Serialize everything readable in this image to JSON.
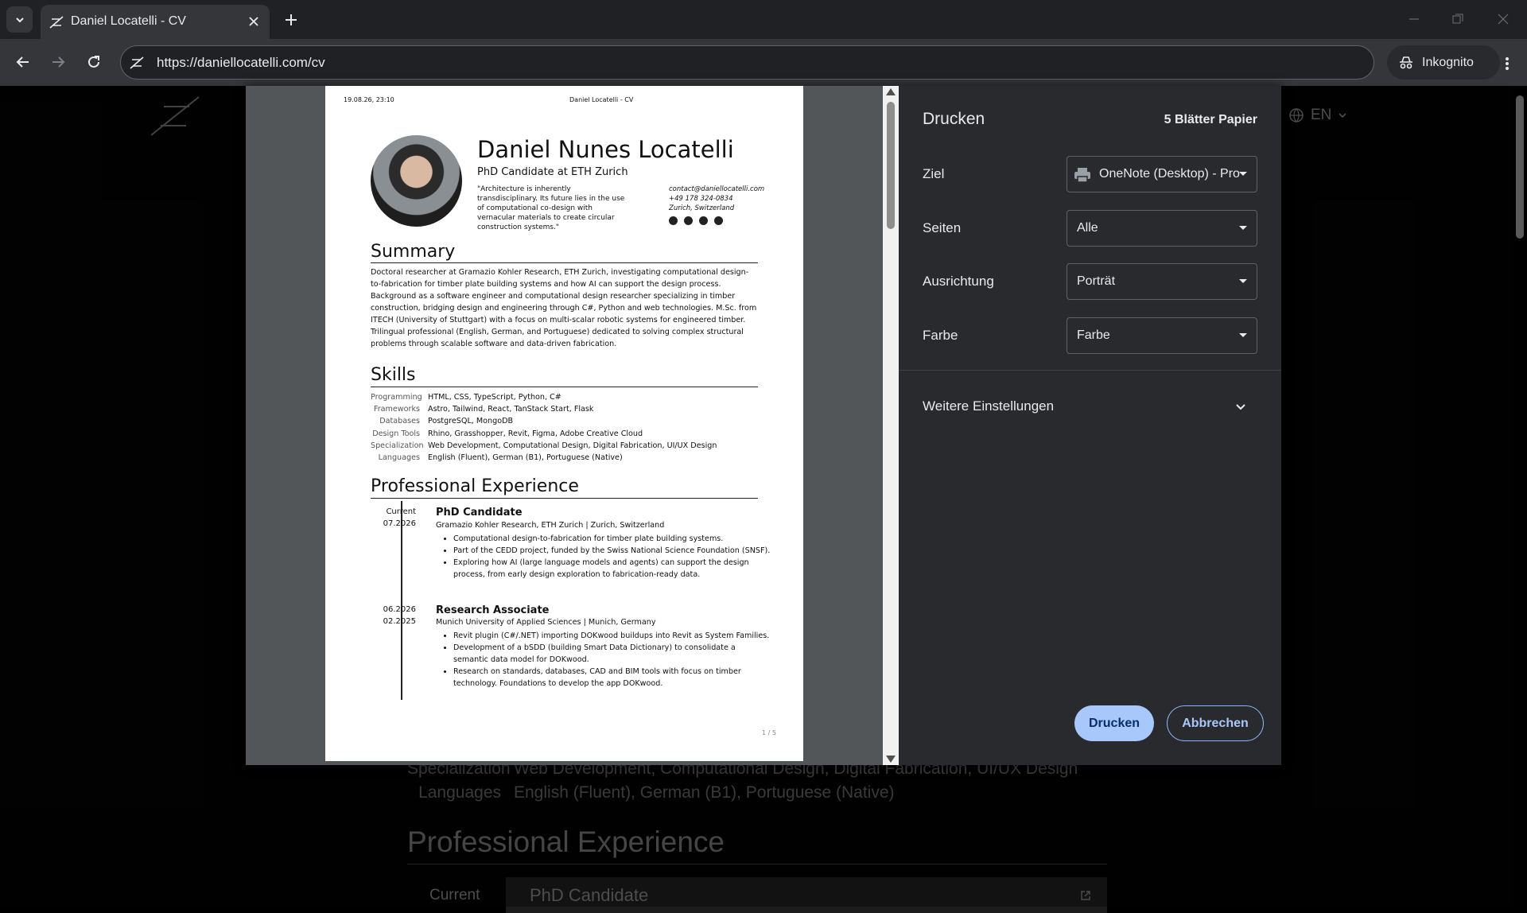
{
  "browser": {
    "tab_title": "Daniel Locatelli - CV",
    "url": "https://daniellocatelli.com/cv",
    "incognito_label": "Inkognito"
  },
  "site": {
    "lang": "EN",
    "bg_skills": [
      {
        "label": "Specialization",
        "value": "Web Development, Computational Design, Digital Fabrication, UI/UX Design"
      },
      {
        "label": "Languages",
        "value": "English (Fluent), German (B1), Portuguese (Native)"
      }
    ],
    "bg_heading": "Professional Experience",
    "bg_current": "Current",
    "bg_card_title": "PhD Candidate"
  },
  "cv": {
    "print_date": "19.08.26, 23:10",
    "print_title": "Daniel Locatelli - CV",
    "name": "Daniel Nunes Locatelli",
    "role": "PhD Candidate at ETH Zurich",
    "quote": "\"Architecture is inherently transdisciplinary. Its future lies in the use of computational co-design with vernacular materials to create circular construction systems.\"",
    "contact": [
      "contact@daniellocatelli.com",
      "+49 178 324-0834",
      "Zurich, Switzerland"
    ],
    "summary_heading": "Summary",
    "summary": "Doctoral researcher at Gramazio Kohler Research, ETH Zurich, investigating computational design-to-fabrication for timber plate building systems and how AI can support the design process. Background as a software engineer and computational design researcher specializing in timber construction, bridging design and engineering through C#, Python and web technologies. M.Sc. from ITECH (University of Stuttgart) with a focus on multi-scalar robotic systems for engineered timber. Trilingual professional (English, German, and Portuguese) dedicated to solving complex structural problems through scalable software and data-driven fabrication.",
    "skills_heading": "Skills",
    "skills": [
      {
        "label": "Programming",
        "value": "HTML, CSS, TypeScript, Python, C#"
      },
      {
        "label": "Frameworks",
        "value": "Astro, Tailwind, React, TanStack Start, Flask"
      },
      {
        "label": "Databases",
        "value": "PostgreSQL, MongoDB"
      },
      {
        "label": "Design Tools",
        "value": "Rhino, Grasshopper, Revit, Figma, Adobe Creative Cloud"
      },
      {
        "label": "Specialization",
        "value": "Web Development, Computational Design, Digital Fabrication, UI/UX Design"
      },
      {
        "label": "Languages",
        "value": "English (Fluent), German (B1), Portuguese (Native)"
      }
    ],
    "experience_heading": "Professional Experience",
    "experience": [
      {
        "date_end": "Current",
        "date_start": "07.2026",
        "role": "PhD Candidate",
        "org": "Gramazio Kohler Research, ETH Zurich | Zurich, Switzerland",
        "bullets": [
          "Computational design-to-fabrication for timber plate building systems.",
          "Part of the CEDD project, funded by the Swiss National Science Foundation (SNSF).",
          "Exploring how AI (large language models and agents) can support the design process, from early design exploration to fabrication-ready data."
        ]
      },
      {
        "date_end": "06.2026",
        "date_start": "02.2025",
        "role": "Research Associate",
        "org": "Munich University of Applied Sciences | Munich, Germany",
        "bullets": [
          "Revit plugin (C#/.NET) importing DOKwood buildups into Revit as System Families.",
          "Development of a bSDD (building Smart Data Dictionary) to consolidate a semantic data model for DOKwood.",
          "Research on standards, databases, CAD and BIM tools with focus on timber technology. Foundations to develop the app DOKwood."
        ]
      }
    ],
    "page_number": "1 / 5"
  },
  "print": {
    "title": "Drucken",
    "sheets": "5 Blätter Papier",
    "destination_label": "Ziel",
    "destination_value": "OneNote (Desktop) - Pro",
    "pages_label": "Seiten",
    "pages_value": "Alle",
    "orientation_label": "Ausrichtung",
    "orientation_value": "Porträt",
    "color_label": "Farbe",
    "color_value": "Farbe",
    "more_settings": "Weitere Einstellungen",
    "print_button": "Drucken",
    "cancel_button": "Abbrechen"
  },
  "colors": {
    "accent": "#a8c7fa",
    "dialog_bg": "#292a2d",
    "preview_bg": "#525659"
  }
}
